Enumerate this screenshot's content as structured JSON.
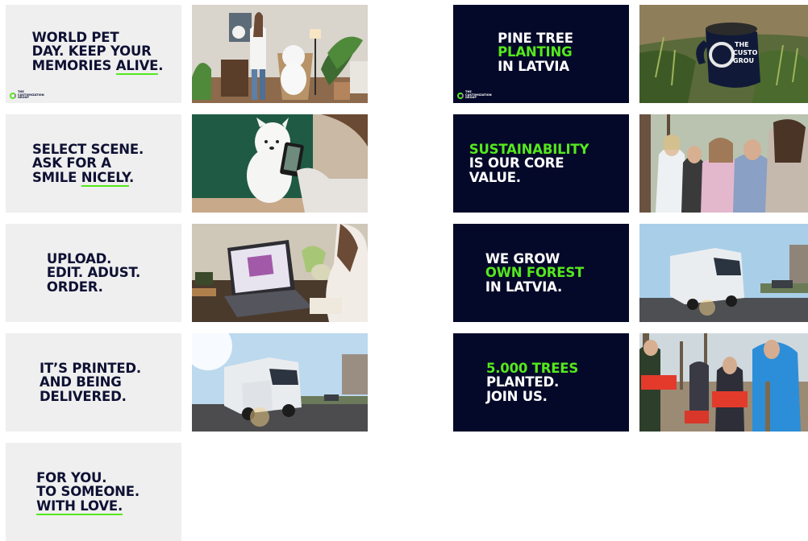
{
  "colors": {
    "light_bg": "#efefef",
    "dark_bg": "#050929",
    "accent": "#54e81d",
    "navy": "#0e1133"
  },
  "cards": {
    "c1": {
      "l1": "WORLD PET",
      "l2": "DAY. KEEP YOUR",
      "l3a": "MEMORIES ",
      "l3b": "ALIVE",
      "l3c": "."
    },
    "c2": {
      "l1": "SELECT SCENE.",
      "l2": "ASK FOR A",
      "l3a": "SMILE ",
      "l3b": "NICELY",
      "l3c": "."
    },
    "c3": {
      "l1": "UPLOAD.",
      "l2": "EDIT. ADUST.",
      "l3": "ORDER."
    },
    "c4": {
      "l1": "IT’S PRINTED.",
      "l2": "AND BEING",
      "l3": "DELIVERED."
    },
    "c5": {
      "l1": "FOR YOU.",
      "l2": "TO SOMEONE.",
      "l3": "WITH LOVE."
    },
    "d1": {
      "l1": "PINE TREE",
      "l2": "PLANTING",
      "l3": "IN LATVIA"
    },
    "d2": {
      "l1": "SUSTAINABILITY",
      "l2": "IS OUR CORE",
      "l3": "VALUE."
    },
    "d3": {
      "l1": "WE GROW",
      "l2": "OWN FOREST",
      "l3": "IN LATVIA."
    },
    "d4": {
      "l1": "5.000 TREES",
      "l2": "PLANTED.",
      "l3": "JOIN US."
    }
  },
  "logo": {
    "l1": "THE",
    "l2": "CUSTOMIZATION",
    "l3": "GROUP"
  },
  "mug_text": {
    "l1": "THE",
    "l2": "CUSTO",
    "l3": "GROU"
  },
  "icons": {
    "logo": "customization-group-ring-logo"
  }
}
